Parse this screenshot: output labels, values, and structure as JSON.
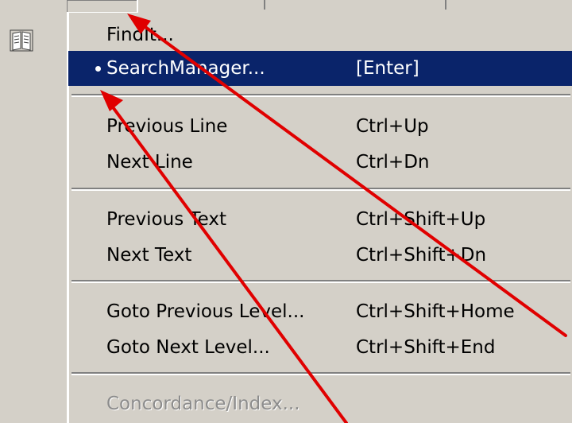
{
  "menu": {
    "items": [
      {
        "label": "FindIt...",
        "shortcut": ""
      },
      {
        "label": "SearchManager...",
        "shortcut": "[Enter]"
      },
      {
        "label": "Previous Line",
        "shortcut": "Ctrl+Up"
      },
      {
        "label": "Next Line",
        "shortcut": "Ctrl+Dn"
      },
      {
        "label": "Previous Text",
        "shortcut": "Ctrl+Shift+Up"
      },
      {
        "label": "Next Text",
        "shortcut": "Ctrl+Shift+Dn"
      },
      {
        "label": "Goto Previous Level...",
        "shortcut": "Ctrl+Shift+Home"
      },
      {
        "label": "Goto Next Level...",
        "shortcut": "Ctrl+Shift+End"
      },
      {
        "label": "Concordance/Index...",
        "shortcut": ""
      }
    ]
  },
  "colors": {
    "menu_bg": "#d4d0c8",
    "highlight_bg": "#0a246a",
    "highlight_text": "#ffffff",
    "disabled_text": "#8c8c8c",
    "annotation_arrow": "#e00000"
  },
  "icons": {
    "left_toolbar": "book-icon",
    "selected_marker": "bullet-icon"
  }
}
